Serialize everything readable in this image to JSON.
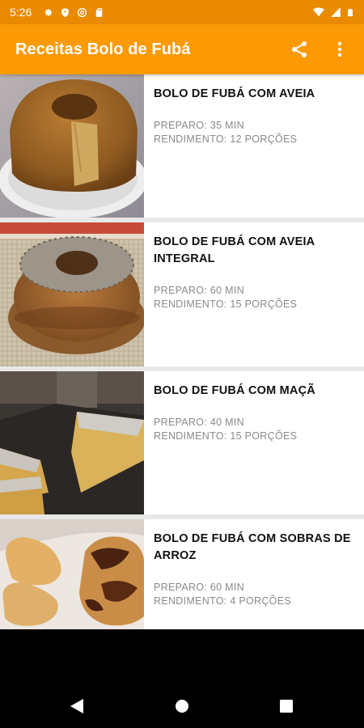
{
  "status_bar": {
    "time": "5:26",
    "left_icons": [
      "gear-icon",
      "shield-icon",
      "at-sign-icon",
      "sd-card-icon"
    ],
    "right_icons": [
      "wifi-icon",
      "signal-icon",
      "battery-icon"
    ]
  },
  "app_bar": {
    "title": "Receitas Bolo de Fubá",
    "actions": [
      "share-icon",
      "more-vert-icon"
    ],
    "color": "#fb9a05"
  },
  "recipes": [
    {
      "title": "BOLO DE FUBÁ COM AVEIA",
      "prep": "PREPARO: 35 MIN",
      "yield": "RENDIMENTO: 12 PORÇÕES",
      "image": "bundt-cake-slice-photo"
    },
    {
      "title": "BOLO DE FUBÁ COM AVEIA INTEGRAL",
      "prep": "PREPARO: 60 MIN",
      "yield": "RENDIMENTO: 15 PORÇÕES",
      "image": "ring-cake-oat-topping-photo"
    },
    {
      "title": "BOLO DE FUBÁ COM MAÇÃ",
      "prep": "PREPARO: 40 MIN",
      "yield": "RENDIMENTO: 15 PORÇÕES",
      "image": "sliced-apple-cake-photo"
    },
    {
      "title": "BOLO DE FUBÁ COM SOBRAS DE ARROZ",
      "prep": "PREPARO: 60 MIN",
      "yield": "RENDIMENTO: 4 PORÇÕES",
      "image": "heart-cookies-marble-cake-photo"
    }
  ],
  "nav_bar": {
    "buttons": [
      "back-icon",
      "home-icon",
      "recents-icon"
    ]
  }
}
